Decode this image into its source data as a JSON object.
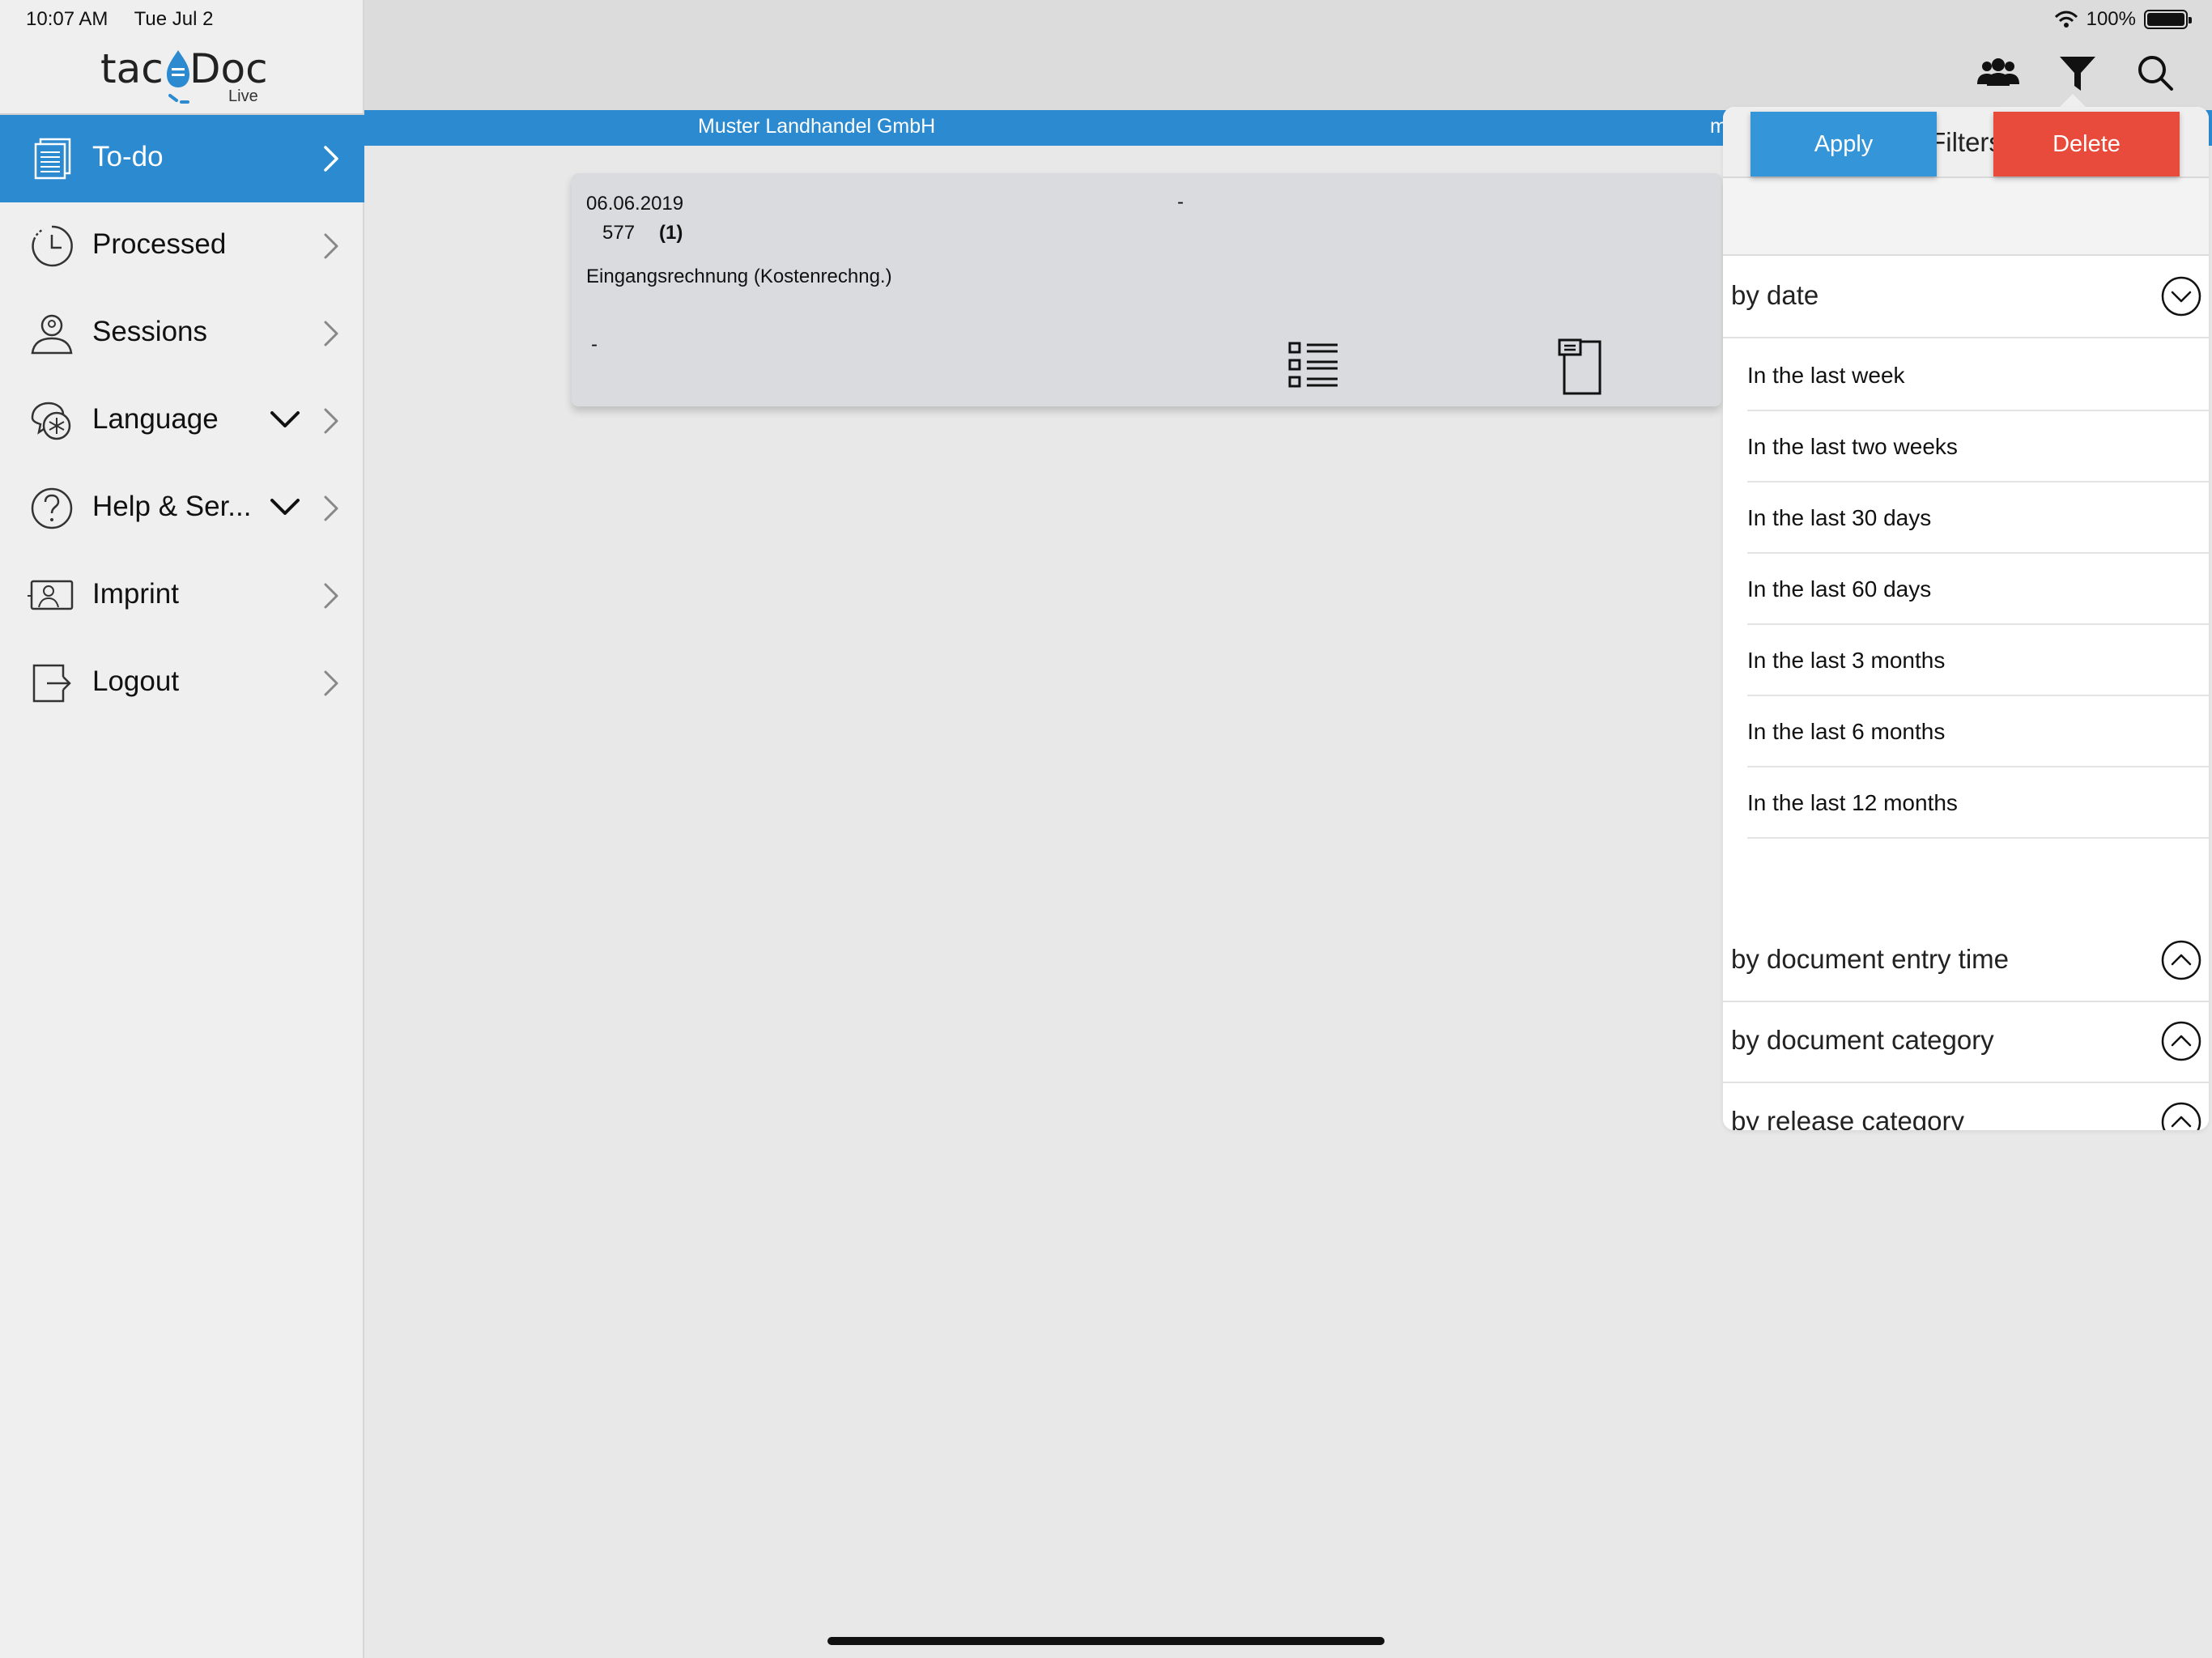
{
  "status_bar": {
    "time": "10:07 AM",
    "date": "Tue Jul 2",
    "battery": "100%"
  },
  "logo": {
    "part1": "tac",
    "part2": "Doc",
    "sub": "Live"
  },
  "sidebar": {
    "items": [
      {
        "label": "To-do",
        "icon": "documents-icon",
        "active": true
      },
      {
        "label": "Processed",
        "icon": "history-clock-icon"
      },
      {
        "label": "Sessions",
        "icon": "user-badge-icon"
      },
      {
        "label": "Language",
        "icon": "speech-bubbles-icon",
        "expandable": true
      },
      {
        "label": "Help & Ser...",
        "icon": "question-circle-icon",
        "expandable": true
      },
      {
        "label": "Imprint",
        "icon": "id-card-icon"
      },
      {
        "label": "Logout",
        "icon": "logout-icon"
      }
    ]
  },
  "topbar": {
    "icons": [
      "users-icon",
      "filter-icon",
      "search-icon"
    ]
  },
  "header": {
    "company": "Muster Landhandel GmbH",
    "truncated": "m"
  },
  "document": {
    "date": "06.06.2019",
    "dash_top": "-",
    "number": "577",
    "count": "(1)",
    "type": "Eingangsrechnung (Kostenrechng.)",
    "dash_bottom": "-"
  },
  "filters": {
    "title": "Filters",
    "apply_label": "Apply",
    "delete_label": "Delete",
    "date_section": {
      "label": "by date",
      "options": [
        "In the last week",
        "In the last two weeks",
        "In the last 30 days",
        "In the last 60 days",
        "In the last 3 months",
        "In the last 6 months",
        "In the last 12 months"
      ]
    },
    "other_sections": [
      "by document entry time",
      "by document category",
      "by release category"
    ]
  },
  "colors": {
    "accent": "#2b8ad0",
    "apply": "#3495d8",
    "delete": "#e84b3c"
  }
}
